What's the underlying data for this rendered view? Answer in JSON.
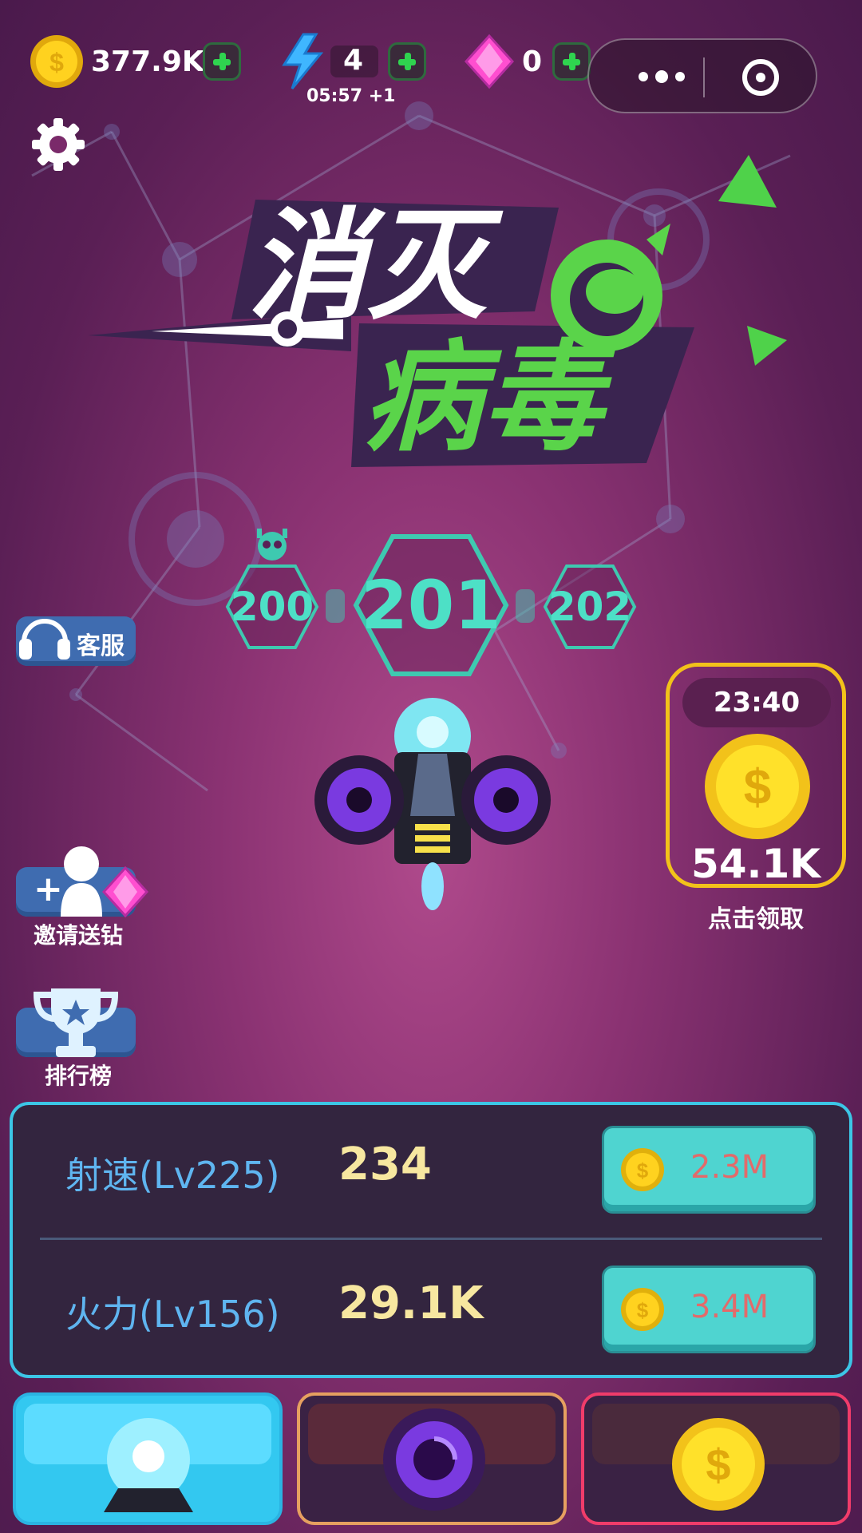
{
  "resources": {
    "coins": "377.9K",
    "energy": "4",
    "energy_timer": "05:57 +1",
    "gems": "0"
  },
  "level": {
    "previous": "200",
    "current": "201",
    "next": "202"
  },
  "side_buttons": {
    "customer_service": "客服",
    "invite": "邀请送钻",
    "leaderboard": "排行榜"
  },
  "offline_reward": {
    "timer": "23:40",
    "amount": "54.1K",
    "claim_label": "点击领取"
  },
  "upgrades": [
    {
      "label": "射速(Lv225)",
      "value": "234",
      "price": "2.3M"
    },
    {
      "label": "火力(Lv156)",
      "value": "29.1K",
      "price": "3.4M"
    }
  ],
  "colors": {
    "accent_cyan": "#4de0c6",
    "coin_gold": "#f7d21a",
    "gem_pink": "#ff4fd0",
    "energy_blue": "#3fb6ff",
    "plus_green": "#2fd44f",
    "title_green": "#5ad44a"
  },
  "icons": {
    "coin": "coin-icon",
    "energy": "lightning-icon",
    "gem": "gem-icon",
    "settings": "gear-icon",
    "more": "more-dots-icon",
    "close_mini": "target-icon"
  }
}
